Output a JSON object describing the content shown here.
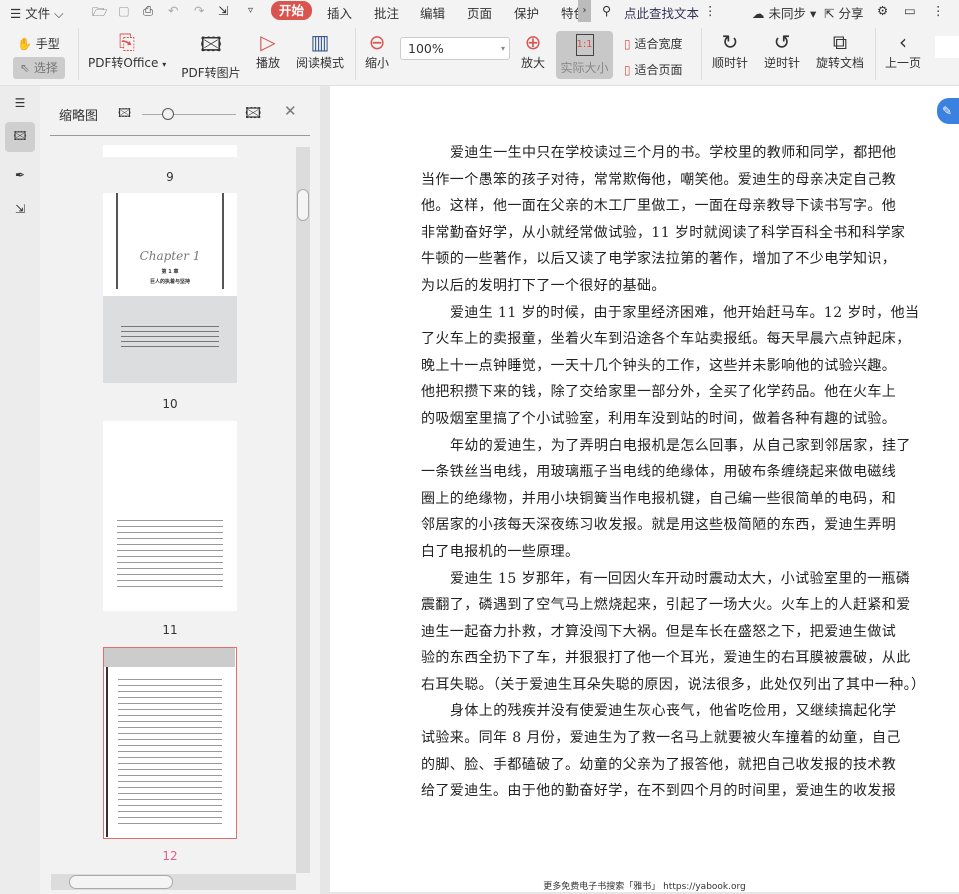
{
  "menubar": {
    "file": "文件",
    "tabs": [
      "开始",
      "插入",
      "批注",
      "编辑",
      "页面",
      "保护",
      "特色"
    ],
    "search_placeholder": "点此查找文本",
    "sync": "未同步",
    "share": "分享"
  },
  "ribbon": {
    "hand": "手型",
    "select": "选择",
    "pdf_to_office": "PDF转Office",
    "pdf_to_image": "PDF转图片",
    "play": "播放",
    "read_mode": "阅读模式",
    "zoom_out": "缩小",
    "zoom_value": "100%",
    "zoom_in": "放大",
    "actual_size": "实际大小",
    "actual_size_glyph": "1:1",
    "fit_width": "适合宽度",
    "fit_page": "适合页面",
    "clockwise": "顺时针",
    "counterclockwise": "逆时针",
    "rotate_doc": "旋转文档",
    "prev_page": "上一页"
  },
  "thumbnails": {
    "title": "缩略图",
    "pages": [
      "9",
      "10",
      "11",
      "12"
    ],
    "current": "12",
    "chapter_script": "Chapter 1",
    "chapter_num": "第 1 章",
    "chapter_title": "巨人的执着与坚持"
  },
  "document": {
    "paragraphs": [
      [
        "爱迪生一生中只在学校读过三个月的书。学校里的教师和同学，都把他",
        "当作一个愚笨的孩子对待，常常欺侮他，嘲笑他。爱迪生的母亲决定自己教",
        "他。这样，他一面在父亲的木工厂里做工，一面在母亲教导下读书写字。他",
        "非常勤奋好学，从小就经常做试验，11 岁时就阅读了科学百科全书和科学家",
        "牛顿的一些著作，以后又读了电学家法拉第的著作，增加了不少电学知识，",
        "为以后的发明打下了一个很好的基础。"
      ],
      [
        "爱迪生 11 岁的时候，由于家里经济困难，他开始赶马车。12 岁时，他当",
        "了火车上的卖报童，坐着火车到沿途各个车站卖报纸。每天早晨六点钟起床，",
        "晚上十一点钟睡觉，一天十几个钟头的工作，这些并未影响他的试验兴趣。",
        "他把积攒下来的钱，除了交给家里一部分外，全买了化学药品。他在火车上",
        "的吸烟室里搞了个小试验室，利用车没到站的时间，做着各种有趣的试验。"
      ],
      [
        "年幼的爱迪生，为了弄明白电报机是怎么回事，从自己家到邻居家，挂了",
        "一条铁丝当电线，用玻璃瓶子当电线的绝缘体，用破布条缠绕起来做电磁线",
        "圈上的绝缘物，并用小块铜簧当作电报机键，自己编一些很简单的电码，和",
        "邻居家的小孩每天深夜练习收发报。就是用这些极简陋的东西，爱迪生弄明",
        "白了电报机的一些原理。"
      ],
      [
        "爱迪生 15 岁那年，有一回因火车开动时震动太大，小试验室里的一瓶磷",
        "震翻了，磷遇到了空气马上燃烧起来，引起了一场大火。火车上的人赶紧和爱",
        "迪生一起奋力扑救，才算没闯下大祸。但是车长在盛怒之下，把爱迪生做试",
        "验的东西全扔下了车，并狠狠打了他一个耳光，爱迪生的右耳膜被震破，从此",
        "右耳失聪。（关于爱迪生耳朵失聪的原因，说法很多，此处仅列出了其中一种。）"
      ],
      [
        "身体上的残疾并没有使爱迪生灰心丧气，他省吃俭用，又继续搞起化学",
        "试验来。同年 8 月份，爱迪生为了救一名马上就要被火车撞着的幼童，自己",
        "的脚、脸、手都磕破了。幼童的父亲为了报答他，就把自己收发报的技术教",
        "给了爱迪生。由于他的勤奋好学，在不到四个月的时间里，爱迪生的收发报"
      ]
    ],
    "footer": "更多免费电子书搜索「雅书」 https://yabook.org"
  },
  "colors": {
    "accent": "#d9534f",
    "current_page": "#e0608a"
  }
}
